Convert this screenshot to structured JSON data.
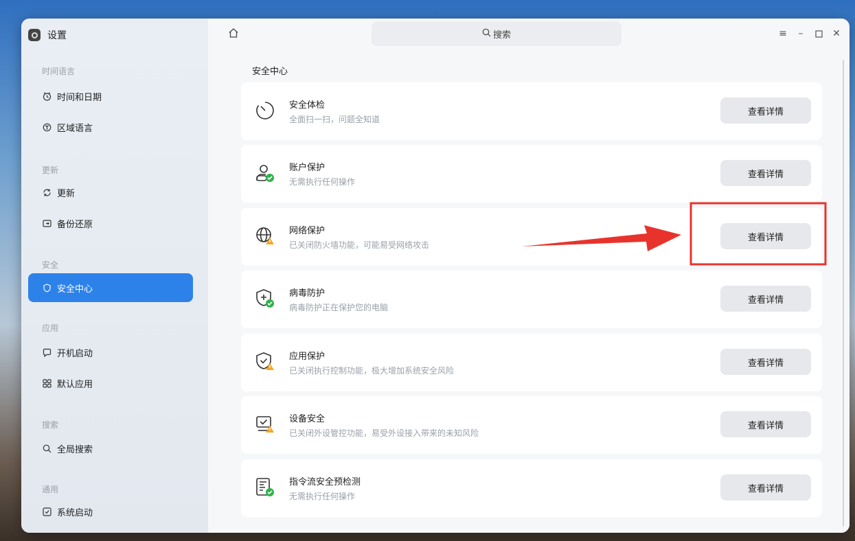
{
  "app": {
    "title": "设置"
  },
  "sidebar": {
    "groups": [
      {
        "label": "时间语言"
      },
      {
        "label": "更新"
      },
      {
        "label": "安全"
      },
      {
        "label": "应用"
      },
      {
        "label": "搜索"
      },
      {
        "label": "通用"
      }
    ],
    "items": [
      {
        "label": "时间和日期",
        "icon": "clock-icon"
      },
      {
        "label": "区域语言",
        "icon": "globe-icon"
      },
      {
        "label": "更新",
        "icon": "refresh-icon"
      },
      {
        "label": "备份还原",
        "icon": "backup-icon"
      },
      {
        "label": "安全中心",
        "icon": "shield-icon"
      },
      {
        "label": "开机启动",
        "icon": "startup-icon"
      },
      {
        "label": "默认应用",
        "icon": "apps-grid-icon"
      },
      {
        "label": "全局搜索",
        "icon": "search-icon"
      },
      {
        "label": "系统启动",
        "icon": "system-boot-icon"
      }
    ]
  },
  "header": {
    "search_placeholder": "搜索"
  },
  "main": {
    "section_title": "安全中心",
    "cards": [
      {
        "title": "安全体检",
        "desc": "全面扫一扫，问题全知道",
        "button": "查看详情",
        "icon": "scan-icon"
      },
      {
        "title": "账户保护",
        "desc": "无需执行任何操作",
        "button": "查看详情",
        "icon": "account-protect-icon"
      },
      {
        "title": "网络保护",
        "desc": "已关闭防火墙功能，可能易受网络攻击",
        "button": "查看详情",
        "icon": "network-protect-icon"
      },
      {
        "title": "病毒防护",
        "desc": "病毒防护正在保护您的电脑",
        "button": "查看详情",
        "icon": "virus-protect-icon"
      },
      {
        "title": "应用保护",
        "desc": "已关闭执行控制功能，极大增加系统安全风险",
        "button": "查看详情",
        "icon": "app-protect-icon"
      },
      {
        "title": "设备安全",
        "desc": "已关闭外设管控功能，易受外设接入带来的未知风险",
        "button": "查看详情",
        "icon": "device-security-icon"
      },
      {
        "title": "指令流安全预检测",
        "desc": "无需执行任何操作",
        "button": "查看详情",
        "icon": "instruction-flow-icon"
      }
    ]
  },
  "colors": {
    "accent": "#2d82ea",
    "annotation_red": "#e8332d",
    "success_green": "#2fb34a",
    "warning_orange": "#f5a623"
  }
}
